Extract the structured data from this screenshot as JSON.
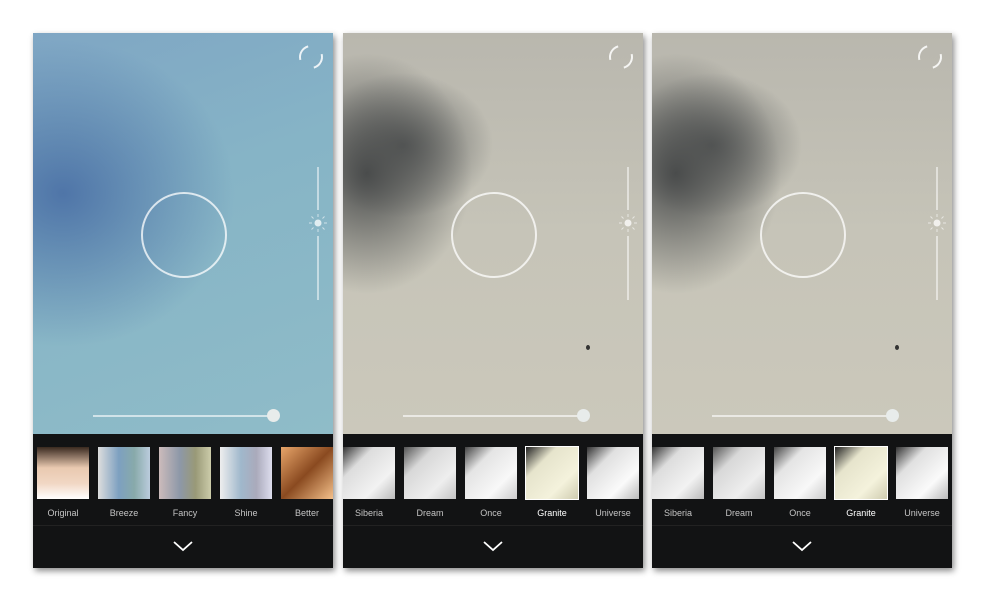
{
  "panels": [
    {
      "filters": [
        "Original",
        "Breeze",
        "Fancy",
        "Shine",
        "Better"
      ],
      "selected": null,
      "exposure_pct": 100
    },
    {
      "filters": [
        "Siberia",
        "Dream",
        "Once",
        "Granite",
        "Universe"
      ],
      "selected": "Granite",
      "exposure_pct": 100
    },
    {
      "filters": [
        "Siberia",
        "Dream",
        "Once",
        "Granite",
        "Universe"
      ],
      "selected": "Granite",
      "exposure_pct": 100
    }
  ],
  "icons": {
    "refresh": "refresh-icon",
    "brightness": "sun-icon",
    "collapse": "chevron-down-icon"
  },
  "colors": {
    "bottom_bar": "#121314",
    "text": "#c4c4c4"
  }
}
